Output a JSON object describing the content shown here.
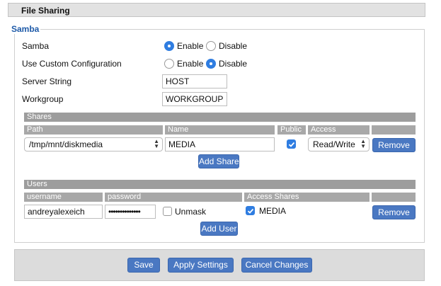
{
  "page": {
    "title": "File Sharing"
  },
  "samba": {
    "legend": "Samba",
    "samba_label": "Samba",
    "samba_options": [
      "Enable",
      "Disable"
    ],
    "samba_selected": "Enable",
    "custom_config_label": "Use Custom Configuration",
    "custom_config_options": [
      "Enable",
      "Disable"
    ],
    "custom_config_selected": "Disable",
    "server_string_label": "Server String",
    "server_string_value": "HOST",
    "workgroup_label": "Workgroup",
    "workgroup_value": "WORKGROUP"
  },
  "shares": {
    "section_title": "Shares",
    "columns": [
      "Path",
      "Name",
      "Public",
      "Access"
    ],
    "rows": [
      {
        "path": "/tmp/mnt/diskmedia",
        "name": "MEDIA",
        "public": true,
        "access": "Read/Write",
        "remove_label": "Remove"
      }
    ],
    "add_label": "Add Share"
  },
  "users": {
    "section_title": "Users",
    "columns": [
      "username",
      "password",
      "Access Shares"
    ],
    "rows": [
      {
        "username": "andreyalexeich",
        "password": "••••••••••••••",
        "unmask_label": "Unmask",
        "unmask_checked": false,
        "share": "MEDIA",
        "share_checked": true,
        "remove_label": "Remove"
      }
    ],
    "add_label": "Add User"
  },
  "footer": {
    "save_label": "Save",
    "apply_label": "Apply Settings",
    "cancel_label": "Cancel Changes"
  },
  "colors": {
    "button_blue": "#4a78c2",
    "legend_blue": "#1e5aa8",
    "header_gray": "#9d9d9d",
    "radio_checked": "#2f7de1"
  }
}
